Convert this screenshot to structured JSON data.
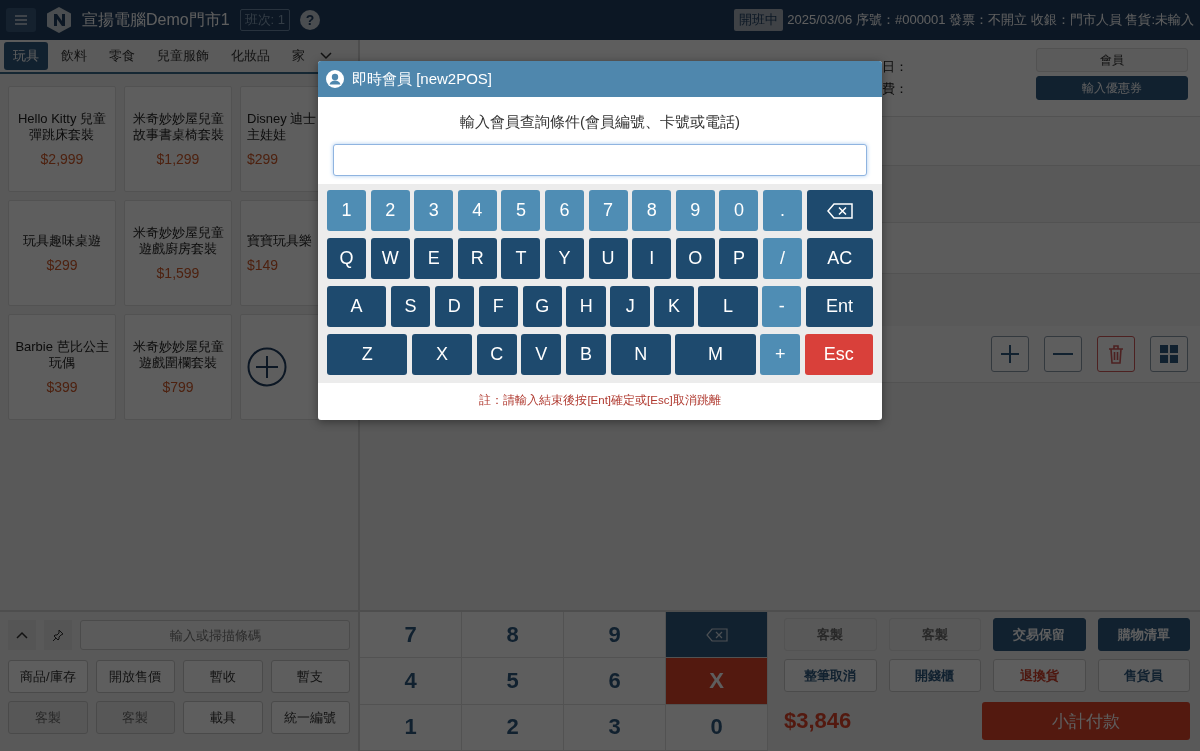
{
  "header": {
    "store_name": "宣揚電腦Demo門市1",
    "shift": "班次: 1",
    "help": "?",
    "status": "開班中",
    "info": "2025/03/06 序號：#000001 發票：不開立 收銀：門市人員 售貨:未輸入"
  },
  "categories": [
    {
      "label": "玩具",
      "selected": true
    },
    {
      "label": "飲料",
      "selected": false
    },
    {
      "label": "零食",
      "selected": false
    },
    {
      "label": "兒童服飾",
      "selected": false
    },
    {
      "label": "化妝品",
      "selected": false
    },
    {
      "label": "家",
      "selected": false
    }
  ],
  "products": [
    {
      "kind": "item",
      "name_lines": [
        "Hello Kitty 兒童",
        "彈跳床套裝"
      ],
      "price": "$2,999"
    },
    {
      "kind": "item",
      "name_lines": [
        "米奇妙妙屋兒童",
        "故事書桌椅套裝"
      ],
      "price": "$1,299"
    },
    {
      "kind": "item",
      "name_lines": [
        "Disney 迪士",
        "主娃娃"
      ],
      "price": "$299"
    },
    {
      "kind": "item",
      "name_lines": [
        "玩具趣味桌遊"
      ],
      "price": "$299"
    },
    {
      "kind": "item",
      "name_lines": [
        "米奇妙妙屋兒童",
        "遊戲廚房套裝"
      ],
      "price": "$1,599"
    },
    {
      "kind": "item",
      "name_lines": [
        "寶寶玩具樂"
      ],
      "price": "$149"
    },
    {
      "kind": "item",
      "name_lines": [
        "Barbie 芭比公主",
        "玩偶"
      ],
      "price": "$399"
    },
    {
      "kind": "item",
      "name_lines": [
        "米奇妙妙屋兒童",
        "遊戲圍欄套裝"
      ],
      "price": "$799"
    },
    {
      "kind": "add"
    }
  ],
  "barcode": {
    "placeholder": "輸入或掃描條碼"
  },
  "quick_buttons": [
    {
      "label": "商品/庫存",
      "disabled": false
    },
    {
      "label": "開放售價",
      "disabled": false
    },
    {
      "label": "暫收",
      "disabled": false
    },
    {
      "label": "暫支",
      "disabled": false
    },
    {
      "label": "客製",
      "disabled": true
    },
    {
      "label": "客製",
      "disabled": true
    },
    {
      "label": "載具",
      "disabled": false
    },
    {
      "label": "統一編號",
      "disabled": false
    }
  ],
  "member": {
    "fields": [
      "日：",
      "費："
    ],
    "member_button": "會員",
    "coupon_button": "輸入優惠券"
  },
  "keypad": [
    {
      "kind": "digit",
      "label": "7"
    },
    {
      "kind": "digit",
      "label": "8"
    },
    {
      "kind": "digit",
      "label": "9"
    },
    {
      "kind": "backspace"
    },
    {
      "kind": "digit",
      "label": "4"
    },
    {
      "kind": "digit",
      "label": "5"
    },
    {
      "kind": "digit",
      "label": "6"
    },
    {
      "kind": "clear",
      "label": "X"
    },
    {
      "kind": "digit",
      "label": "1"
    },
    {
      "kind": "digit",
      "label": "2"
    },
    {
      "kind": "digit",
      "label": "3"
    },
    {
      "kind": "digit",
      "label": "0"
    }
  ],
  "actions": [
    {
      "label": "客製",
      "kind": "disabled"
    },
    {
      "label": "客製",
      "kind": "disabled"
    },
    {
      "label": "交易保留",
      "kind": "primary"
    },
    {
      "label": "購物清單",
      "kind": "primary"
    },
    {
      "label": "整筆取消",
      "kind": "outline"
    },
    {
      "label": "開錢櫃",
      "kind": "outline"
    },
    {
      "label": "退換貨",
      "kind": "danger"
    },
    {
      "label": "售貨員",
      "kind": "outline"
    }
  ],
  "total": "$3,846",
  "checkout": "小計付款",
  "dialog": {
    "title": "即時會員 [new2POS]",
    "prompt": "輸入會員查詢條件(會員編號、卡號或電話)",
    "note": "註：請輸入結束後按[Ent]確定或[Esc]取消跳離",
    "key_rows": [
      [
        {
          "kind": "light",
          "label": "1"
        },
        {
          "kind": "light",
          "label": "2"
        },
        {
          "kind": "light",
          "label": "3"
        },
        {
          "kind": "light",
          "label": "4"
        },
        {
          "kind": "light",
          "label": "5"
        },
        {
          "kind": "light",
          "label": "6"
        },
        {
          "kind": "light",
          "label": "7"
        },
        {
          "kind": "light",
          "label": "8"
        },
        {
          "kind": "light",
          "label": "9"
        },
        {
          "kind": "light",
          "label": "0"
        },
        {
          "kind": "light",
          "label": "."
        },
        {
          "kind": "backspace"
        }
      ],
      [
        {
          "kind": "dark",
          "label": "Q"
        },
        {
          "kind": "dark",
          "label": "W"
        },
        {
          "kind": "dark",
          "label": "E"
        },
        {
          "kind": "dark",
          "label": "R"
        },
        {
          "kind": "dark",
          "label": "T"
        },
        {
          "kind": "dark",
          "label": "Y"
        },
        {
          "kind": "dark",
          "label": "U"
        },
        {
          "kind": "dark",
          "label": "I"
        },
        {
          "kind": "dark",
          "label": "O"
        },
        {
          "kind": "dark",
          "label": "P"
        },
        {
          "kind": "light",
          "label": "/"
        },
        {
          "kind": "dark",
          "label": "AC"
        }
      ],
      [
        {
          "kind": "dark",
          "label": "A"
        },
        {
          "kind": "dark",
          "label": "S"
        },
        {
          "kind": "dark",
          "label": "D"
        },
        {
          "kind": "dark",
          "label": "F"
        },
        {
          "kind": "dark",
          "label": "G"
        },
        {
          "kind": "dark",
          "label": "H"
        },
        {
          "kind": "dark",
          "label": "J"
        },
        {
          "kind": "dark",
          "label": "K"
        },
        {
          "kind": "dark",
          "label": "L"
        },
        {
          "kind": "light",
          "label": "-"
        },
        {
          "kind": "dark",
          "label": "Ent"
        }
      ],
      [
        {
          "kind": "dark",
          "label": "Z"
        },
        {
          "kind": "dark",
          "label": "X"
        },
        {
          "kind": "dark",
          "label": "C"
        },
        {
          "kind": "dark",
          "label": "V"
        },
        {
          "kind": "dark",
          "label": "B"
        },
        {
          "kind": "dark",
          "label": "N"
        },
        {
          "kind": "dark",
          "label": "M"
        },
        {
          "kind": "light",
          "label": "+"
        },
        {
          "kind": "red",
          "label": "Esc"
        }
      ]
    ]
  }
}
